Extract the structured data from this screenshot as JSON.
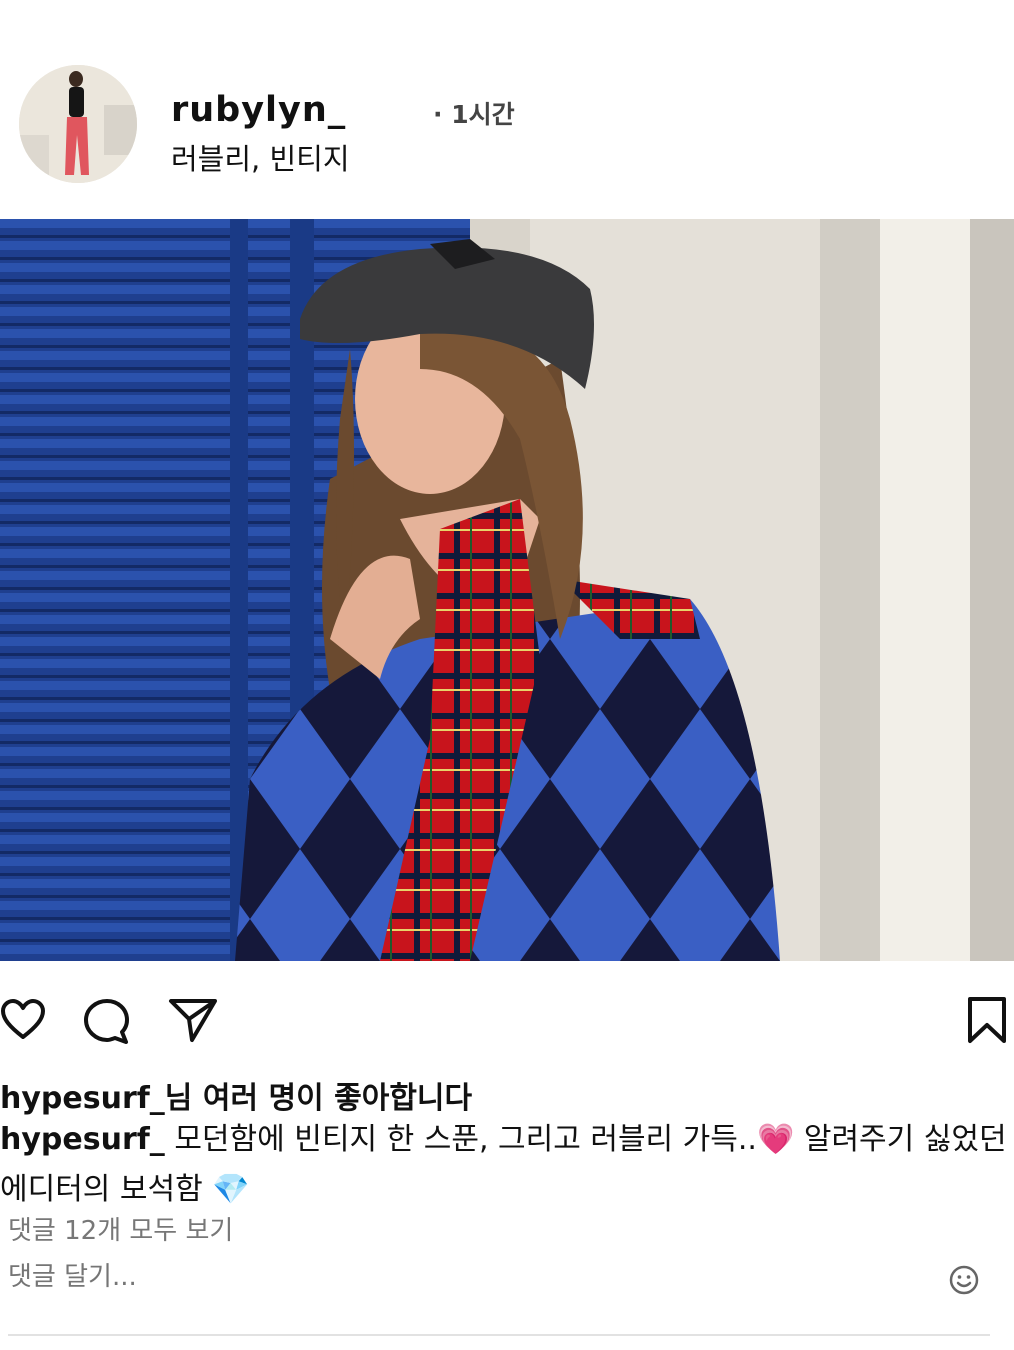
{
  "post": {
    "username": "rubylyn_",
    "subtitle": "러블리, 빈티지",
    "time": "· 1시간"
  },
  "actions": {
    "icons": [
      "heart-icon",
      "comment-icon",
      "share-icon",
      "bookmark-icon"
    ]
  },
  "likes": {
    "user": "hypesurf_",
    "text": "님 여러 명이 좋아합니다"
  },
  "caption": {
    "user": "hypesurf_",
    "text": " 모던함에 빈티지 한 스푼, 그리고 러블리 가득..💗 알려주기 싫었던 에디터의 보석함 💎"
  },
  "comments": {
    "view_all": "댓글 12개 모두 보기",
    "placeholder": "댓글 달기..."
  },
  "colors": {
    "shutter_blue": "#1f3f8f",
    "scarf_red": "#c8141c",
    "argyle_blue": "#3a5fc4",
    "muted_text": "#777777"
  }
}
